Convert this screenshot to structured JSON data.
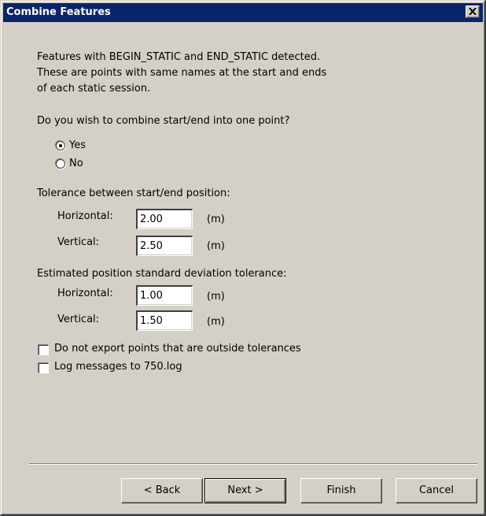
{
  "window": {
    "title": "Combine Features"
  },
  "intro": {
    "line1": "Features with BEGIN_STATIC and END_STATIC detected.",
    "line2": "These are points with same names at the start and ends",
    "line3": "of each static session."
  },
  "combine": {
    "question": "Do you wish to combine start/end into one point?",
    "options": [
      {
        "label": "Yes",
        "selected": true
      },
      {
        "label": "No",
        "selected": false
      }
    ]
  },
  "tolerance": {
    "heading": "Tolerance between start/end position:",
    "horizontal_label": "Horizontal:",
    "horizontal_value": "2.00",
    "vertical_label": "Vertical:",
    "vertical_value": "2.50",
    "unit": "(m)"
  },
  "std_dev": {
    "heading": "Estimated position standard deviation tolerance:",
    "horizontal_label": "Horizontal:",
    "horizontal_value": "1.00",
    "vertical_label": "Vertical:",
    "vertical_value": "1.50",
    "unit": "(m)"
  },
  "checkboxes": [
    {
      "label": "Do not export points that are outside tolerances",
      "checked": false
    },
    {
      "label": "Log messages to 750.log",
      "checked": false
    }
  ],
  "buttons": {
    "back": "< Back",
    "next": "Next >",
    "finish": "Finish",
    "cancel": "Cancel"
  },
  "colors": {
    "titlebar": "#0a246a",
    "face": "#d4d0c8"
  }
}
